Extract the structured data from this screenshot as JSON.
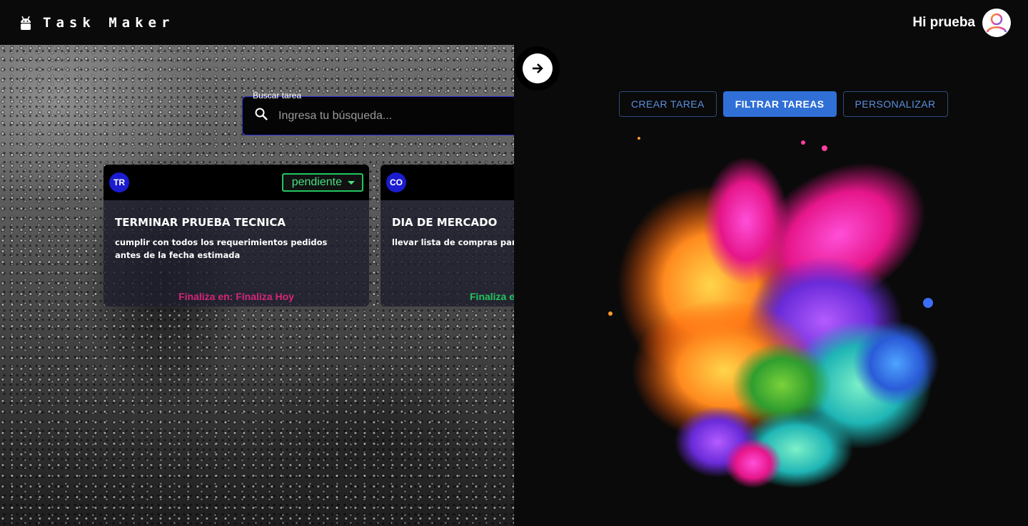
{
  "header": {
    "app_title": "Task Maker",
    "greeting": "Hi prueba",
    "logo_icon": "android-icon",
    "avatar_icon": "user-avatar-icon"
  },
  "search": {
    "label": "Buscar tarea",
    "placeholder": "Ingresa tu búsqueda...",
    "value": ""
  },
  "tasks": [
    {
      "initials": "TR",
      "status": "pendiente",
      "title": "TERMINAR PRUEBA TECNICA",
      "description": "cumplir con todos los requerimientos pedidos antes de la fecha estimada",
      "due": "Finaliza en: Finaliza Hoy",
      "due_color": "#d6247a"
    },
    {
      "initials": "CO",
      "status": "",
      "title": "DIA DE MERCADO",
      "description": "llevar lista de compras para",
      "due": "Finaliza e",
      "due_color": "#22c55e"
    }
  ],
  "actions": {
    "create": "CREAR TAREA",
    "filter": "FILTRAR TAREAS",
    "customize": "PERSONALIZAR"
  },
  "colors": {
    "accent": "#2f6fd6",
    "status_green": "#22c55e",
    "badge_blue": "#1c1ccf"
  }
}
